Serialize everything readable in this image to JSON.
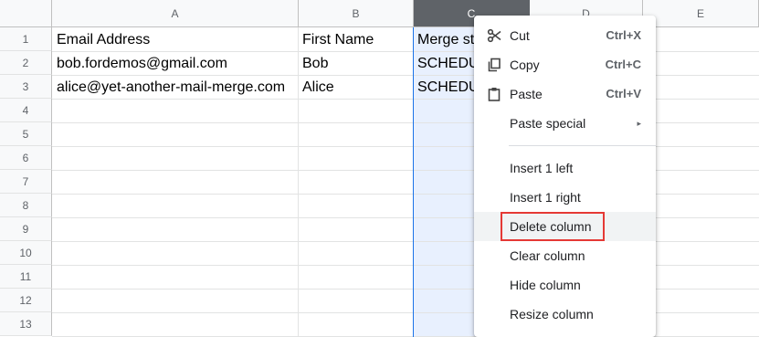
{
  "columns": [
    "A",
    "B",
    "C",
    "D",
    "E"
  ],
  "rows": [
    "1",
    "2",
    "3",
    "4",
    "5",
    "6",
    "7",
    "8",
    "9",
    "10",
    "11",
    "12",
    "13"
  ],
  "cells": {
    "a1": "Email Address",
    "b1": "First Name",
    "c1": "Merge st",
    "a2": "bob.fordemos@gmail.com",
    "b2": "Bob",
    "c2": "SCHEDU",
    "a3": "alice@yet-another-mail-merge.com",
    "b3": "Alice",
    "c3": "SCHEDU"
  },
  "context_menu": {
    "cut": {
      "label": "Cut",
      "shortcut": "Ctrl+X",
      "icon": "scissors-icon"
    },
    "copy": {
      "label": "Copy",
      "shortcut": "Ctrl+C",
      "icon": "copy-icon"
    },
    "paste": {
      "label": "Paste",
      "shortcut": "Ctrl+V",
      "icon": "clipboard-icon"
    },
    "paste_special": {
      "label": "Paste special",
      "submenu": "▸"
    },
    "insert_left": {
      "label": "Insert 1 left"
    },
    "insert_right": {
      "label": "Insert 1 right"
    },
    "delete_column": {
      "label": "Delete column"
    },
    "clear_column": {
      "label": "Clear column"
    },
    "hide_column": {
      "label": "Hide column"
    },
    "resize_column": {
      "label": "Resize column"
    }
  },
  "colors": {
    "selected_header": "#5f6368",
    "selection_fill": "#e8f0fe",
    "selection_border": "#1a73e8",
    "highlight_box": "#e53935"
  }
}
